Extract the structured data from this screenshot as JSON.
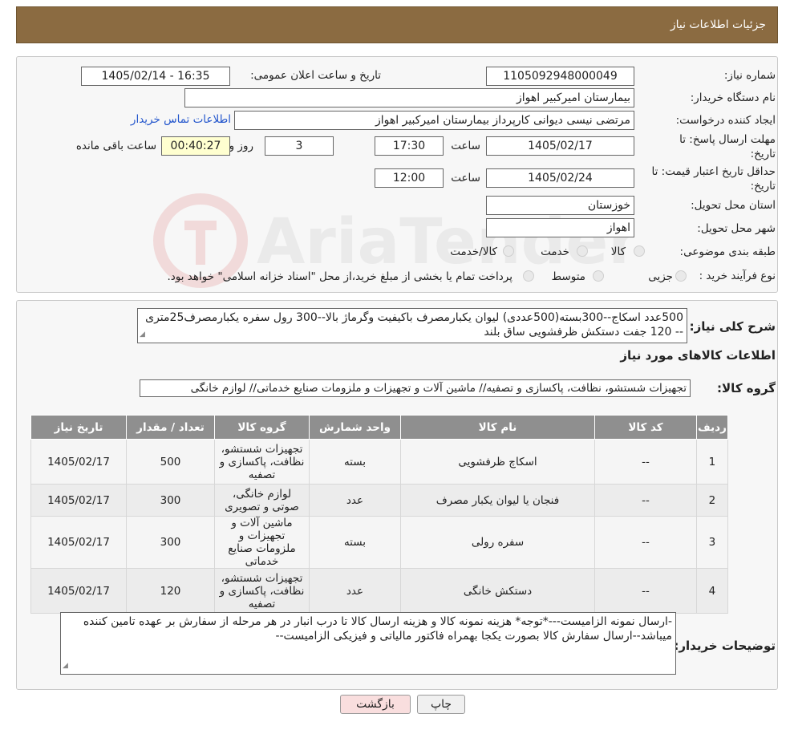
{
  "header": {
    "title": "جزئیات اطلاعات نیاز"
  },
  "form": {
    "need_number_label": "شماره نیاز:",
    "need_number": "1105092948000049",
    "announce_label": "تاریخ و ساعت اعلان عمومی:",
    "announce_value": "1405/02/14 - 16:35",
    "buyer_org_label": "نام دستگاه خریدار:",
    "buyer_org": "بیمارستان امیرکبیر اهواز",
    "creator_label": "ایجاد کننده درخواست:",
    "creator": "مرتضی نیسی دیوانی کارپرداز بیمارستان امیرکبیر اهواز",
    "contact_link": "اطلاعات تماس خریدار",
    "deadline_label_1": "مهلت ارسال پاسخ: تا",
    "deadline_label_2": "تاریخ:",
    "deadline_date": "1405/02/17",
    "time_label": "ساعت",
    "deadline_time": "17:30",
    "days_value": "3",
    "days_label": "روز و",
    "remaining_time": "00:40:27",
    "remaining_label": "ساعت باقی مانده",
    "validity_label_1": "حداقل تاریخ اعتبار قیمت: تا",
    "validity_label_2": "تاریخ:",
    "validity_date": "1405/02/24",
    "validity_time_label": "ساعت",
    "validity_time": "12:00",
    "province_label": "استان محل تحویل:",
    "province": "خوزستان",
    "city_label": "شهر محل تحویل:",
    "city": "اهواز",
    "category_label": "طبقه بندی موضوعی:",
    "category_options": [
      "کالا",
      "خدمت",
      "کالا/خدمت"
    ],
    "purchase_type_label": "نوع فرآیند خرید :",
    "purchase_options": [
      "جزیی",
      "متوسط"
    ],
    "purchase_note": "پرداخت تمام یا بخشی از مبلغ خرید،از محل \"اسناد خزانه اسلامی\" خواهد بود."
  },
  "description": {
    "label": "شرح کلی نیاز:",
    "text": "500عدد اسکاج--300بسته(500عددی) لیوان یکبارمصرف باکیفیت وگرماژ بالا--300 رول سفره یکبارمصرف25متری -- 120 جفت دستکش ظرفشویی ساق بلند"
  },
  "goods_section_title": "اطلاعات کالاهای مورد نیاز",
  "goods_group": {
    "label": "گروه کالا:",
    "value": "تجهیزات شستشو، نظافت، پاکسازی و تصفیه// ماشین آلات و تجهیزات و ملزومات صنایع خدماتی// لوازم خانگی"
  },
  "table": {
    "headers": [
      "ردیف",
      "کد کالا",
      "نام کالا",
      "واحد شمارش",
      "گروه کالا",
      "تعداد / مقدار",
      "تاریخ نیاز"
    ],
    "rows": [
      [
        "1",
        "--",
        "اسکاچ ظرفشویی",
        "بسته",
        "تجهیزات شستشو، نظافت، پاکسازی و تصفیه",
        "500",
        "1405/02/17"
      ],
      [
        "2",
        "--",
        "فنجان یا لیوان یکبار مصرف",
        "عدد",
        "لوازم خانگی، صوتی و تصویری",
        "300",
        "1405/02/17"
      ],
      [
        "3",
        "--",
        "سفره رولی",
        "بسته",
        "ماشین آلات و تجهیزات و ملزومات صنایع خدماتی",
        "300",
        "1405/02/17"
      ],
      [
        "4",
        "--",
        "دستکش خانگی",
        "عدد",
        "تجهیزات شستشو، نظافت، پاکسازی و تصفیه",
        "120",
        "1405/02/17"
      ]
    ]
  },
  "buyer_notes": {
    "label": "توضیحات خریدار:",
    "text": "-ارسال نمونه الزامیست---*توجه* هزینه نمونه کالا و هزینه ارسال کالا تا درب انبار در هر مرحله از سفارش بر عهده تامین کننده میباشد--ارسال سفارش کالا بصورت یکجا بهمراه فاکتور مالیاتی و فیزیکی الزامیست--"
  },
  "buttons": {
    "print": "چاپ",
    "back": "بازگشت"
  },
  "watermark_text": "AriaTender.neT",
  "colors": {
    "header_bg": "#8b6b41",
    "table_header": "#8f8f8f",
    "back_button": "#f9dede"
  }
}
